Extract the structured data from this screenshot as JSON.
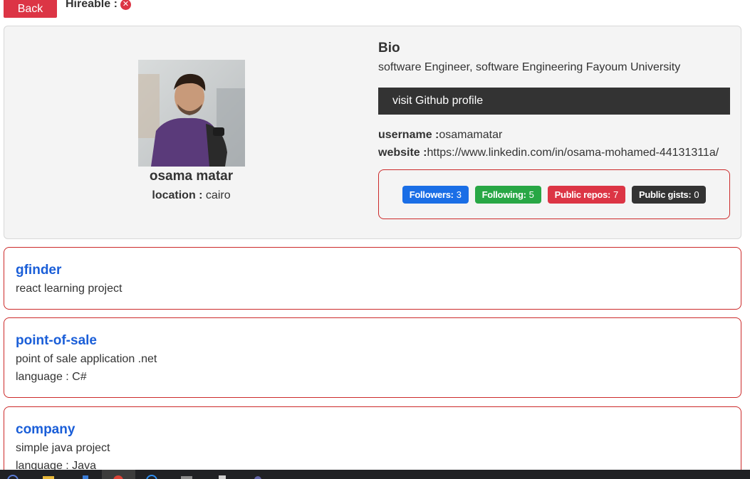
{
  "topbar": {
    "back_label": "Back",
    "hireable_label": "Hireable :",
    "hireable_icon": "x-circle-icon"
  },
  "profile": {
    "name": "osama matar",
    "location_label": "location :",
    "location_value": " cairo",
    "bio_title": "Bio",
    "bio_text": "software Engineer, software Engineering Fayoum University",
    "github_button": "visit Github profile",
    "username_label": "username :",
    "username_value": "osamamatar",
    "website_label": "website :",
    "website_value": "https://www.linkedin.com/in/osama-mohamed-44131311a/"
  },
  "stats": [
    {
      "label": "Followers:",
      "value": "3",
      "color": "#1a6ee6"
    },
    {
      "label": "Following:",
      "value": "5",
      "color": "#28a745"
    },
    {
      "label": "Public repos:",
      "value": "7",
      "color": "#dc3545"
    },
    {
      "label": "Public gists:",
      "value": "0",
      "color": "#333333"
    }
  ],
  "repos": [
    {
      "name": "gfinder",
      "description": "react learning project",
      "language": ""
    },
    {
      "name": "point-of-sale",
      "description": "point of sale application .net",
      "language": "language : C#"
    },
    {
      "name": "company",
      "description": "simple java project",
      "language": "language : Java"
    }
  ],
  "colors": {
    "accent_red": "#dc3545",
    "link_blue": "#1a5ed8",
    "dark": "#333333"
  }
}
